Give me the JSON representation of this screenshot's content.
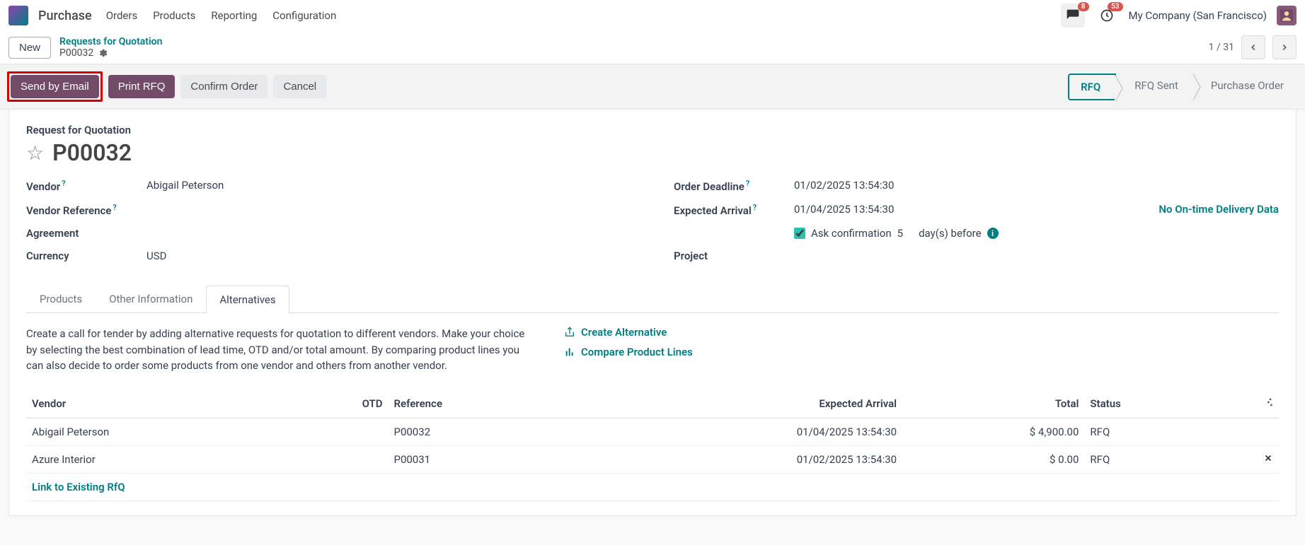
{
  "topnav": {
    "app": "Purchase",
    "items": [
      "Orders",
      "Products",
      "Reporting",
      "Configuration"
    ],
    "chat_badge": "8",
    "clock_badge": "53",
    "company": "My Company (San Francisco)"
  },
  "subhead": {
    "new_label": "New",
    "breadcrumb_link": "Requests for Quotation",
    "breadcrumb_current": "P00032",
    "pager": "1 / 31"
  },
  "actions": {
    "send_email": "Send by Email",
    "print_rfq": "Print RFQ",
    "confirm": "Confirm Order",
    "cancel": "Cancel",
    "status_steps": [
      "RFQ",
      "RFQ Sent",
      "Purchase Order"
    ]
  },
  "form": {
    "subtitle": "Request for Quotation",
    "title": "P00032",
    "left": {
      "vendor_label": "Vendor",
      "vendor_value": "Abigail Peterson",
      "vendor_ref_label": "Vendor Reference",
      "agreement_label": "Agreement",
      "currency_label": "Currency",
      "currency_value": "USD"
    },
    "right": {
      "deadline_label": "Order Deadline",
      "deadline_value": "01/02/2025 13:54:30",
      "expected_label": "Expected Arrival",
      "expected_value": "01/04/2025 13:54:30",
      "delivery_link": "No On-time Delivery Data",
      "ask_label": "Ask confirmation",
      "ask_days": "5",
      "ask_suffix": "day(s) before",
      "project_label": "Project"
    }
  },
  "tabs": {
    "items": [
      "Products",
      "Other Information",
      "Alternatives"
    ],
    "active": 2
  },
  "alt": {
    "text": "Create a call for tender by adding alternative requests for quotation to different vendors. Make your choice by selecting the best combination of lead time, OTD and/or total amount. By comparing product lines you can also decide to order some products from one vendor and others from another vendor.",
    "create": "Create Alternative",
    "compare": "Compare Product Lines",
    "link_existing": "Link to Existing RfQ"
  },
  "table": {
    "headers": {
      "vendor": "Vendor",
      "otd": "OTD",
      "reference": "Reference",
      "expected": "Expected Arrival",
      "total": "Total",
      "status": "Status"
    },
    "rows": [
      {
        "vendor": "Abigail Peterson",
        "otd": "",
        "reference": "P00032",
        "expected": "01/04/2025 13:54:30",
        "total": "$ 4,900.00",
        "status": "RFQ",
        "removable": false
      },
      {
        "vendor": "Azure Interior",
        "otd": "",
        "reference": "P00031",
        "expected": "01/02/2025 13:54:30",
        "total": "$ 0.00",
        "status": "RFQ",
        "removable": true
      }
    ]
  }
}
